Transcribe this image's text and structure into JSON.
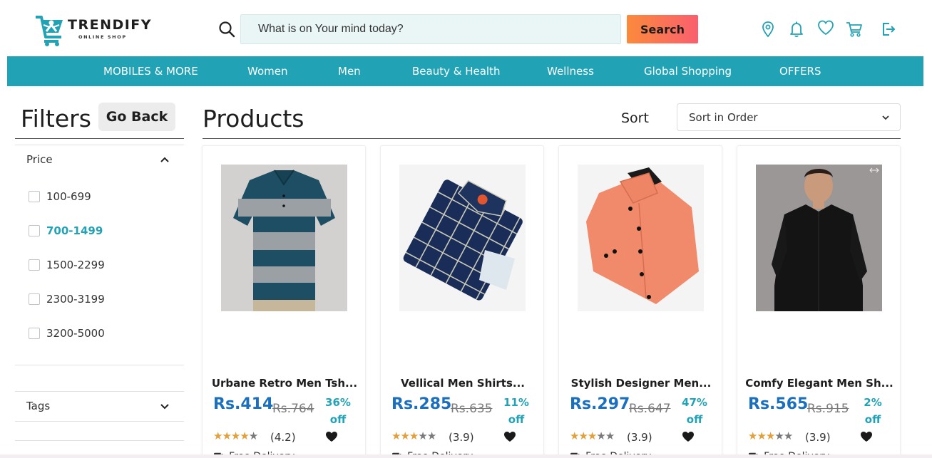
{
  "brand": {
    "name": "TRENDIFY",
    "tagline": "ONLINE SHOP",
    "accent_color": "#22a3b5"
  },
  "header": {
    "search": {
      "placeholder": "What is on Your mind today?",
      "value": "",
      "button_label": "Search"
    },
    "icons": [
      "location-icon",
      "bell-icon",
      "heart-icon",
      "cart-icon",
      "logout-icon"
    ]
  },
  "nav": {
    "items": [
      {
        "label": "MOBILES & MORE"
      },
      {
        "label": "Women"
      },
      {
        "label": "Men"
      },
      {
        "label": "Beauty & Health"
      },
      {
        "label": "Wellness"
      },
      {
        "label": "Global Shopping"
      },
      {
        "label": "OFFERS"
      }
    ]
  },
  "filters": {
    "title": "Filters",
    "go_back_label": "Go Back",
    "price": {
      "label": "Price",
      "expanded": true,
      "options": [
        {
          "label": "100-699",
          "checked": false
        },
        {
          "label": "700-1499",
          "checked": false,
          "highlighted": true
        },
        {
          "label": "1500-2299",
          "checked": false
        },
        {
          "label": "2300-3199",
          "checked": false
        },
        {
          "label": "3200-5000",
          "checked": false
        }
      ]
    },
    "tags": {
      "label": "Tags",
      "expanded": false
    }
  },
  "products": {
    "title": "Products",
    "sort_label": "Sort",
    "sort_value": "Sort in Order",
    "items": [
      {
        "name": "Urbane Retro Men Tsh...",
        "price": "Rs.414",
        "mrp": "Rs.764",
        "off_pct": "36%",
        "off_word": "off",
        "rating": "(4.2)",
        "stars": 4,
        "delivery": "Free Delivery",
        "image": "tshirt-image"
      },
      {
        "name": "Vellical Men Shirts...",
        "price": "Rs.285",
        "mrp": "Rs.635",
        "off_pct": "11%",
        "off_word": "off",
        "rating": "(3.9)",
        "stars": 3,
        "delivery": "Free Delivery",
        "image": "checked-shirt-image"
      },
      {
        "name": "Stylish Designer Men...",
        "price": "Rs.297",
        "mrp": "Rs.647",
        "off_pct": "47%",
        "off_word": "off",
        "rating": "(3.9)",
        "stars": 3,
        "delivery": "Free Delivery",
        "image": "peach-shirt-image"
      },
      {
        "name": "Comfy Elegant Men Sh...",
        "price": "Rs.565",
        "mrp": "Rs.915",
        "off_pct": "2%",
        "off_word": "off",
        "rating": "(3.9)",
        "stars": 3,
        "delivery": "Free Delivery",
        "image": "black-shirt-image"
      }
    ]
  }
}
